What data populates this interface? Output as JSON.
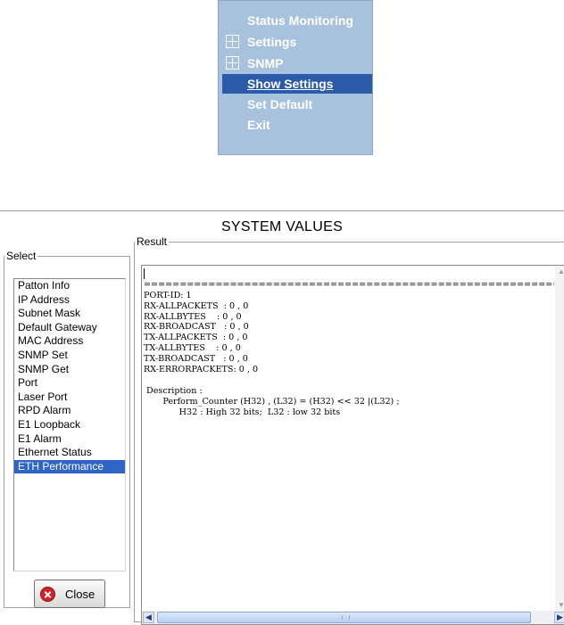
{
  "menu": {
    "items": [
      {
        "label": "Status Monitoring",
        "expandable": false,
        "selected": false
      },
      {
        "label": "Settings",
        "expandable": true,
        "selected": false
      },
      {
        "label": "SNMP",
        "expandable": true,
        "selected": false
      },
      {
        "label": "Show Settings",
        "expandable": false,
        "selected": true
      },
      {
        "label": "Set Default",
        "expandable": false,
        "selected": false
      },
      {
        "label": "Exit",
        "expandable": false,
        "selected": false
      }
    ],
    "colors": {
      "background": "#a8c2dd",
      "selected": "#2a5aa8",
      "text": "#ffffff"
    }
  },
  "dialog": {
    "title": "SYSTEM VALUES",
    "select": {
      "legend": "Select",
      "items": [
        "Patton Info",
        "IP Address",
        "Subnet Mask",
        "Default Gateway",
        "MAC Address",
        "SNMP Set",
        "SNMP Get",
        "Port",
        "Laser Port",
        "RPD Alarm",
        "E1 Loopback",
        "E1 Alarm",
        "Ethernet Status",
        "ETH Performance"
      ],
      "selected_item": "ETH Performance"
    },
    "result": {
      "legend": "Result",
      "lines": [
        "",
        "==========================================================================",
        "PORT-ID: 1",
        "RX-ALLPACKETS  : 0 , 0",
        "RX-ALLBYTES    : 0 , 0",
        "RX-BROADCAST   : 0 , 0",
        "TX-ALLPACKETS  : 0 , 0",
        "TX-ALLBYTES    : 0 , 0",
        "TX-BROADCAST   : 0 , 0",
        "RX-ERRORPACKETS: 0 , 0",
        "",
        " Description :",
        "       Perform_Counter (H32) , (L32) = (H32) << 32 |(L32) ;",
        "             H32 : High 32 bits;  L32 : low 32 bits"
      ]
    },
    "close_button": {
      "label": "Close",
      "icon": "close-x-icon"
    }
  }
}
